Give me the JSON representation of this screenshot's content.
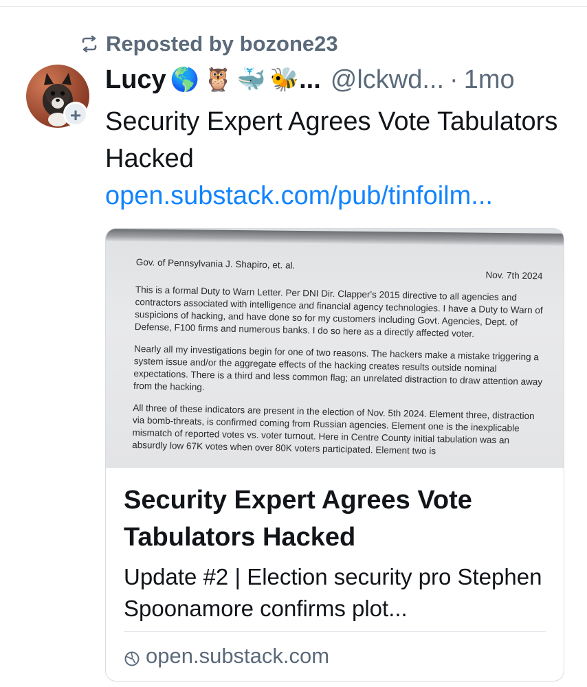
{
  "repost": {
    "label": "Reposted by bozone23"
  },
  "author": {
    "display_name": "Lucy",
    "emojis": [
      "🌎",
      "🦉",
      "🐳",
      "🐝"
    ],
    "truncation": "...",
    "handle": "@lckwd...",
    "separator": "·",
    "time": "1mo",
    "follow_badge": "+"
  },
  "post": {
    "text": "Security Expert Agrees Vote Tabulators Hacked",
    "link_text": "open.substack.com/pub/tinfoilm..."
  },
  "card": {
    "letter": {
      "addressee": "Gov. of Pennsylvania J. Shapiro, et. al.",
      "date": "Nov. 7th 2024",
      "paragraphs": [
        "This is a formal Duty to Warn Letter. Per DNI Dir. Clapper's 2015 directive to all agencies and contractors associated with intelligence and financial agency technologies. I have a Duty to Warn of suspicions of hacking, and have done so for my customers including Govt. Agencies, Dept. of Defense, F100 firms and numerous banks. I do so here as a directly affected voter.",
        "Nearly all my investigations begin for one of two reasons. The hackers make a mistake triggering a system issue and/or the aggregate effects of the hacking creates results outside nominal expectations. There is a third and less common flag; an unrelated distraction to draw attention away from the hacking.",
        "All three of these indicators are present in the election of Nov. 5th 2024. Element three, distraction via bomb-threats, is confirmed coming from Russian agencies. Element one is the inexplicable mismatch of reported votes vs. voter turnout. Here in Centre County initial tabulation was an absurdly low 67K votes when over 80K voters participated. Element two is"
      ]
    },
    "title": "Security Expert Agrees Vote Tabulators Hacked",
    "description": "Update #2 | Election security pro Stephen Spoonamore confirms plot...",
    "domain": "open.substack.com"
  }
}
